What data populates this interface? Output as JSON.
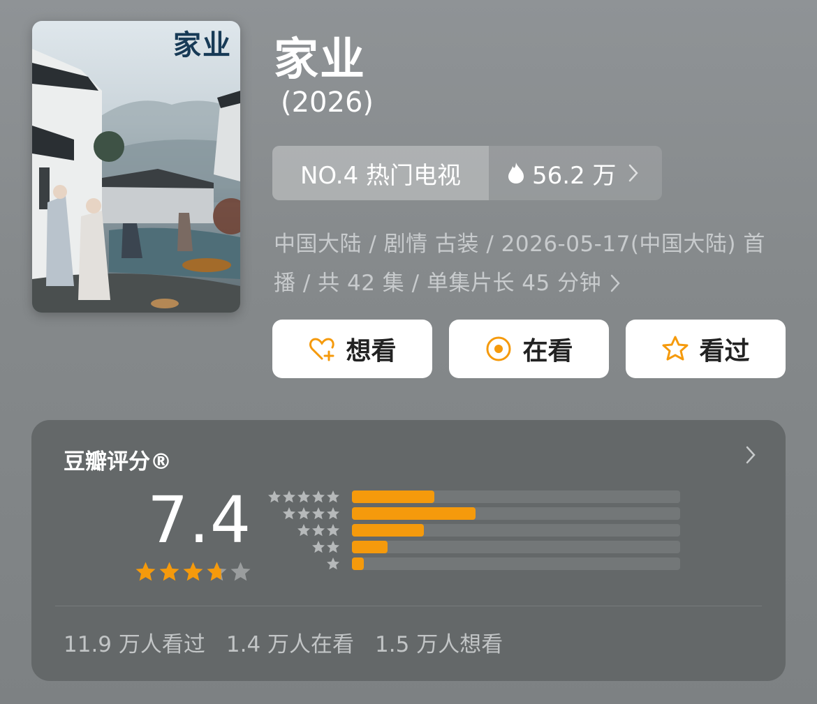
{
  "poster": {
    "title_text": "家业"
  },
  "title": "家业",
  "year": "(2026)",
  "rank": {
    "label": "NO.4 热门电视",
    "heat": "56.2 万",
    "icon": "flame-icon"
  },
  "meta": {
    "line1": "中国大陆 / 剧情 古装 / 2026-05-17(中国大陆) 首",
    "line2": "播 / 共 42 集 / 单集片长 45 分钟"
  },
  "actions": {
    "want": "想看",
    "watching": "在看",
    "watched": "看过"
  },
  "rating": {
    "title": "豆瓣评分®",
    "score": "7.4",
    "star_value": 3.7,
    "distribution": [
      {
        "stars": 5,
        "fraction": 0.25
      },
      {
        "stars": 4,
        "fraction": 0.376
      },
      {
        "stars": 3,
        "fraction": 0.22
      },
      {
        "stars": 2,
        "fraction": 0.108
      },
      {
        "stars": 1,
        "fraction": 0.036
      }
    ],
    "stats": {
      "watched": "11.9 万人看过",
      "watching": "1.4 万人在看",
      "want": "1.5 万人想看"
    }
  },
  "colors": {
    "accent": "#f59a0c",
    "card": "#646869"
  }
}
